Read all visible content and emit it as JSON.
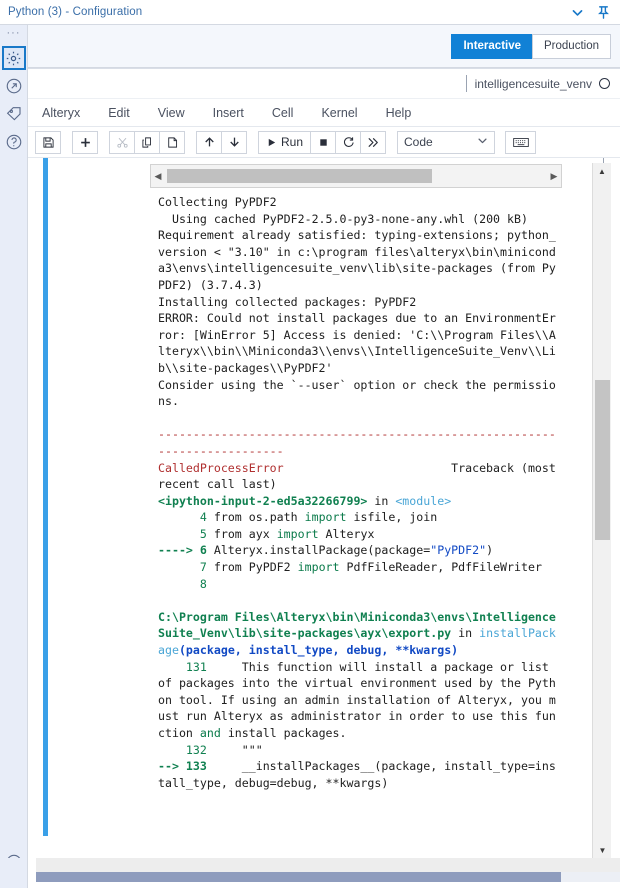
{
  "window": {
    "title": "Python (3) - Configuration",
    "actions": [
      {
        "name": "chevron-down-icon",
        "label": "∨"
      },
      {
        "name": "pin-icon",
        "label": "📌"
      }
    ]
  },
  "rail": {
    "dots": "···",
    "items": [
      {
        "name": "gear-icon",
        "title": "Configuration",
        "selected": true
      },
      {
        "name": "arrow-circle-icon",
        "title": "Output",
        "selected": false
      },
      {
        "name": "tag-icon",
        "title": "Annotation",
        "selected": false
      },
      {
        "name": "help-circle-icon",
        "title": "Help",
        "selected": false
      }
    ],
    "bottom": {
      "name": "check-circle-icon",
      "title": "Status"
    }
  },
  "mode": {
    "options": [
      {
        "label": "Interactive",
        "active": true
      },
      {
        "label": "Production",
        "active": false
      }
    ]
  },
  "notebook": {
    "kernel_name": "intelligencesuite_venv",
    "kernel_status": "idle",
    "menu": [
      "Alteryx",
      "Edit",
      "View",
      "Insert",
      "Cell",
      "Kernel",
      "Help"
    ],
    "toolbar": {
      "save": "💾",
      "add": "✚",
      "cut": "✂",
      "copy": "⧉",
      "paste": "Ὄb",
      "move_up": "↑",
      "move_down": "↓",
      "run_label": "Run",
      "run_icon": "▶",
      "stop": "■",
      "restart": "⟳",
      "restart_run_all": "➤➤",
      "cell_type": "Code",
      "keyboard": "⌨"
    }
  },
  "colors": {
    "accent": "#1181d6",
    "cell_bar": "#3aa0e8",
    "title_text": "#3a6ea8",
    "error_red": "#b03030",
    "code_green": "#108050",
    "string_blue": "#1149c4",
    "path_cyan": "#4aa6d6"
  },
  "output": {
    "lines": [
      {
        "t": "Collecting PyPDF2"
      },
      {
        "t": "  Using cached PyPDF2-2.5.0-py3-none-any.whl (200 kB)"
      },
      {
        "t": "Requirement already satisfied: typing-extensions; python_version < \"3.10\" in c:\\program files\\alteryx\\bin\\miniconda3\\envs\\intelligencesuite_venv\\lib\\site-packages (from PyPDF2) (3.7.4.3)"
      },
      {
        "t": "Installing collected packages: PyPDF2"
      },
      {
        "t": "ERROR: Could not install packages due to an EnvironmentError: [WinError 5] Access is denied: 'C:\\\\Program Files\\\\Alteryx\\\\bin\\\\Miniconda3\\\\envs\\\\IntelligenceSuite_Venv\\\\Lib\\\\site-packages\\\\PyPDF2'"
      },
      {
        "t": "Consider using the `--user` option or check the permissions."
      },
      {
        "t": ""
      },
      {
        "t": "---------------------------------------------------------------------------",
        "c": "red"
      },
      {
        "segs": [
          {
            "t": "CalledProcessError",
            "c": "red"
          },
          {
            "t": "                        Traceback (most recent call last)"
          }
        ]
      },
      {
        "segs": [
          {
            "t": "<ipython-input-2-ed5a32266799>",
            "c": "green bold"
          },
          {
            "t": " in "
          },
          {
            "t": "<module>",
            "c": "cyan"
          }
        ]
      },
      {
        "segs": [
          {
            "t": "      4 ",
            "c": "green"
          },
          {
            "t": "from os.path "
          },
          {
            "t": "import",
            "c": "dgreen"
          },
          {
            "t": " isfile, join"
          }
        ]
      },
      {
        "segs": [
          {
            "t": "      5 ",
            "c": "green"
          },
          {
            "t": "from ayx "
          },
          {
            "t": "import",
            "c": "dgreen"
          },
          {
            "t": " Alteryx"
          }
        ]
      },
      {
        "segs": [
          {
            "t": "----> 6 ",
            "c": "green bold"
          },
          {
            "t": "Alteryx.installPackage(package="
          },
          {
            "t": "\"PyPDF2\"",
            "c": "blue"
          },
          {
            "t": ")"
          }
        ]
      },
      {
        "segs": [
          {
            "t": "      7 ",
            "c": "green"
          },
          {
            "t": "from PyPDF2 "
          },
          {
            "t": "import",
            "c": "dgreen"
          },
          {
            "t": " PdfFileReader, PdfFileWriter"
          }
        ]
      },
      {
        "segs": [
          {
            "t": "      8",
            "c": "green"
          }
        ]
      },
      {
        "t": ""
      },
      {
        "segs": [
          {
            "t": "C:\\Program Files\\Alteryx\\bin\\Miniconda3\\envs\\IntelligenceSuite_Venv\\lib\\site-packages\\ayx\\export.py",
            "c": "green bold"
          },
          {
            "t": " in "
          },
          {
            "t": "installPackage",
            "c": "cyan"
          },
          {
            "t": "(package, install_type, debug, **kwargs)",
            "c": "blue bold"
          }
        ]
      },
      {
        "segs": [
          {
            "t": "    131 ",
            "c": "green"
          },
          {
            "t": "    This function will install a package or list of packages into the virtual environment used by the Python tool. If using an admin installation of Alteryx, you must run Alteryx as administrator in order to use this function "
          },
          {
            "t": "and",
            "c": "dgreen"
          },
          {
            "t": " install packages."
          }
        ]
      },
      {
        "segs": [
          {
            "t": "    132 ",
            "c": "green"
          },
          {
            "t": "    \"\"\""
          }
        ]
      },
      {
        "segs": [
          {
            "t": "--> 133 ",
            "c": "green bold"
          },
          {
            "t": "    __installPackages__(package, install_type=install_type, debug=debug, **kwargs)"
          }
        ]
      }
    ]
  },
  "scrollbars": {
    "cell_horizontal": {
      "left_arrow": "◀",
      "right_arrow": "▶"
    },
    "outer_vertical": {
      "up_arrow": "▲",
      "down_arrow": "▼"
    }
  }
}
